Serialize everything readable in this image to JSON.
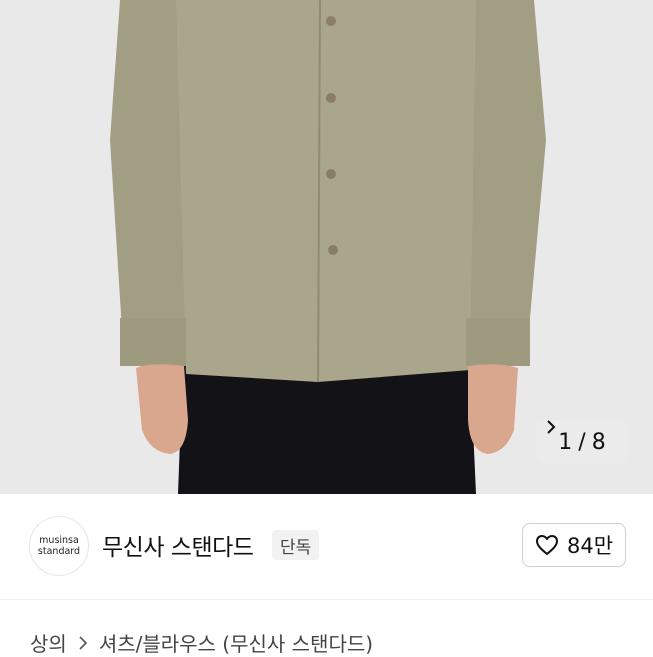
{
  "gallery": {
    "counter_current": "1",
    "counter_separator": "/",
    "counter_total": "8"
  },
  "brand": {
    "logo_line1": "musinsa",
    "logo_line2": "standard",
    "name": "무신사 스탠다드",
    "badge": "단독"
  },
  "like": {
    "count": "84만",
    "icon": "heart-outline-icon"
  },
  "breadcrumb": {
    "items": [
      "상의",
      "셔츠/블라우스 (무신사 스탠다드)"
    ]
  },
  "colors": {
    "shirt": "#a7a489",
    "trousers": "#131317",
    "background": "#e9e9ea"
  }
}
